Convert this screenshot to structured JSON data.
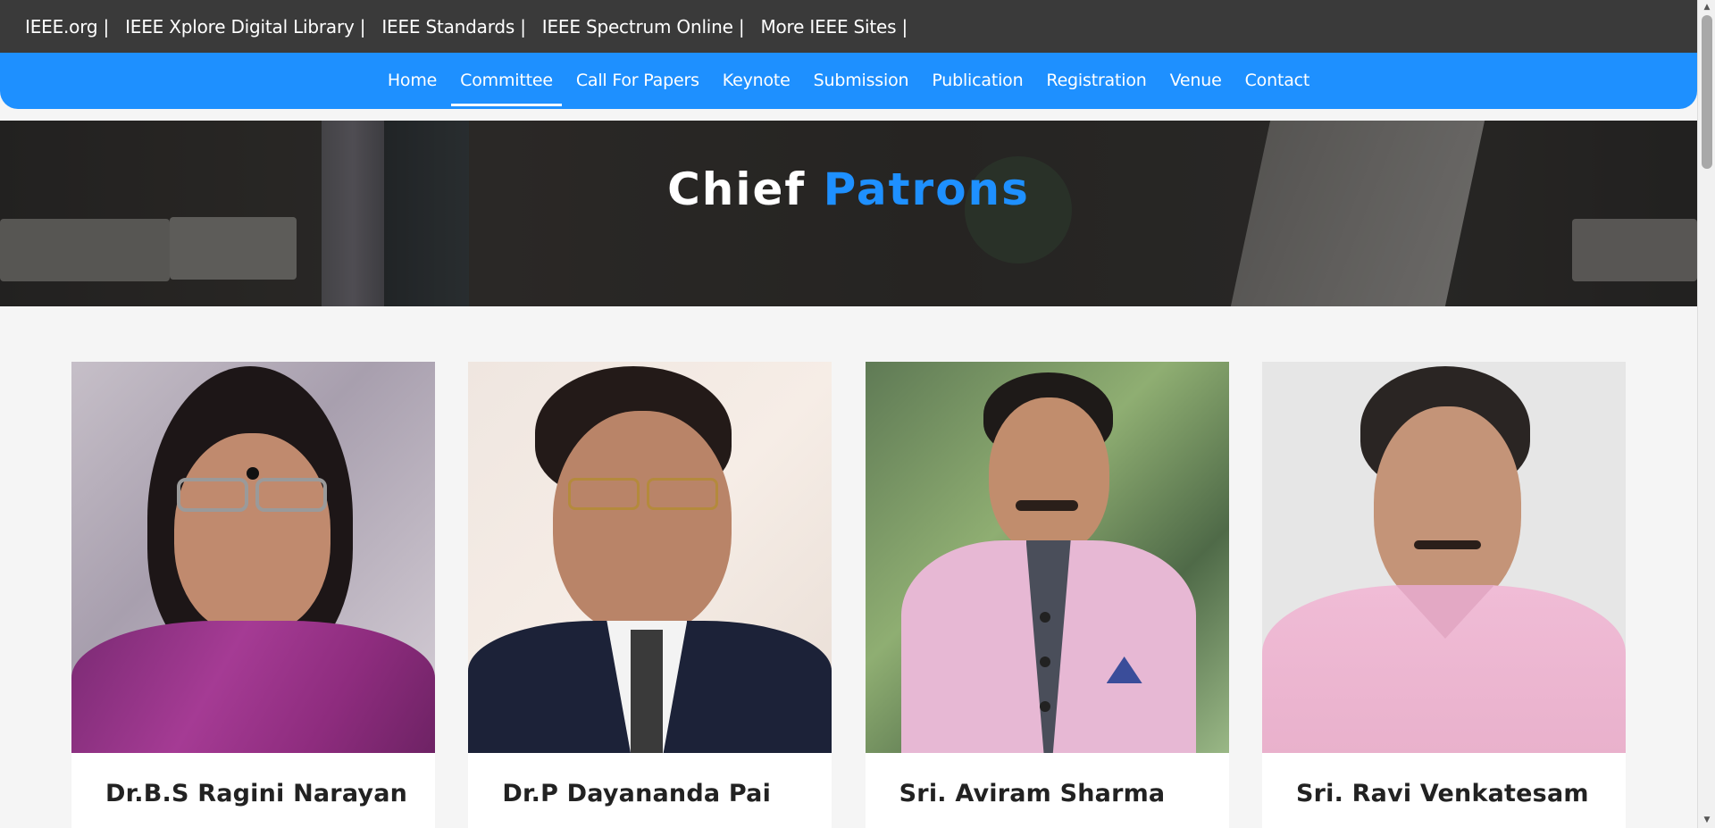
{
  "top_links": [
    {
      "label": "IEEE.org |"
    },
    {
      "label": "IEEE Xplore Digital Library |"
    },
    {
      "label": "IEEE Standards |"
    },
    {
      "label": "IEEE Spectrum Online |"
    },
    {
      "label": "More IEEE Sites |"
    }
  ],
  "nav": {
    "items": [
      {
        "label": "Home"
      },
      {
        "label": "Committee"
      },
      {
        "label": "Call For Papers"
      },
      {
        "label": "Keynote"
      },
      {
        "label": "Submission"
      },
      {
        "label": "Publication"
      },
      {
        "label": "Registration"
      },
      {
        "label": "Venue"
      },
      {
        "label": "Contact"
      }
    ],
    "active": "Committee"
  },
  "hero": {
    "title_part1": "Chief",
    "title_part2": "Patrons"
  },
  "patrons": [
    {
      "name": "Dr.B.S Ragini Narayan"
    },
    {
      "name": "Dr.P Dayananda Pai"
    },
    {
      "name": "Sri. Aviram Sharma"
    },
    {
      "name": "Sri. Ravi Venkatesam"
    }
  ],
  "colors": {
    "topbar": "#3a3a3a",
    "accent": "#1e90ff",
    "page_bg": "#f5f5f5"
  }
}
